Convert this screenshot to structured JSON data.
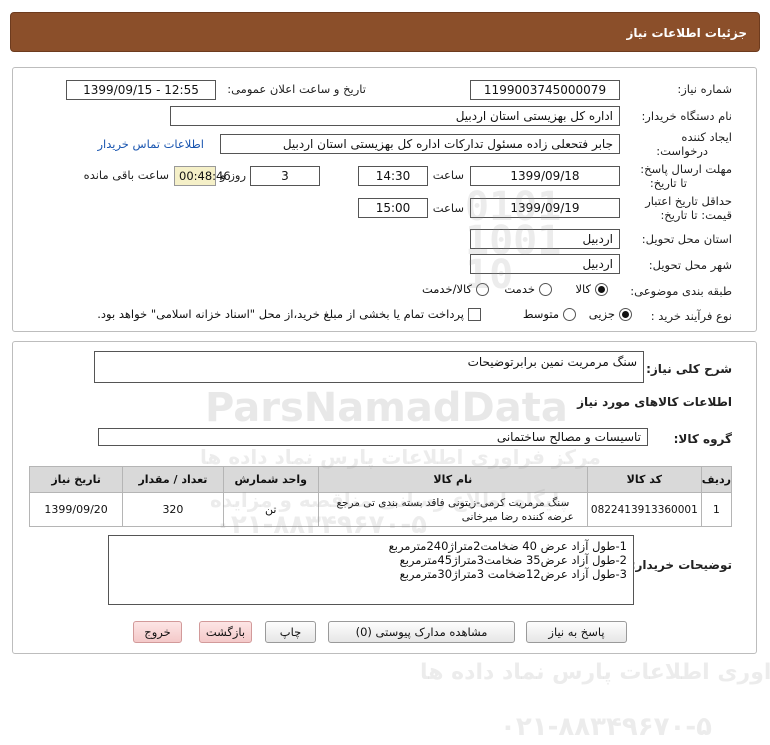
{
  "window": {
    "title": "جزئیات اطلاعات نیاز"
  },
  "form": {
    "need_number_label": "شماره نیاز:",
    "need_number": "1199003745000079",
    "announce_label": "تاریخ و ساعت اعلان عمومی:",
    "announce_value": "1399/09/15 - 12:55",
    "buyer_org_label": "نام دستگاه خریدار:",
    "buyer_org": "اداره کل بهزیستی استان اردبیل",
    "creator_label_1": "ایجاد کننده",
    "creator_label_2": "درخواست:",
    "creator": "جابر فتحعلی زاده مسئول تدارکات اداره کل بهزیستی استان اردبیل",
    "contact_link": "اطلاعات تماس خریدار",
    "deadline_label_1": "مهلت ارسال پاسخ:",
    "deadline_label_2": "تا تاریخ:",
    "deadline_date": "1399/09/18",
    "time_label": "ساعت",
    "deadline_time": "14:30",
    "days_value": "3",
    "days_label": "روز و",
    "remaining_time": "00:48:46",
    "remaining_label": "ساعت باقی مانده",
    "validity_label_1": "حداقل تاریخ اعتبار",
    "validity_label_2": "قیمت: تا تاریخ:",
    "validity_date": "1399/09/19",
    "validity_time_label": "ساعت",
    "validity_time": "15:00",
    "province_label": "استان محل تحویل:",
    "province": "اردبیل",
    "city_label": "شهر محل تحویل:",
    "city": "اردبیل",
    "category_label": "طبقه بندی موضوعی:",
    "category_options": [
      "کالا",
      "خدمت",
      "کالا/خدمت"
    ],
    "category_selected": "کالا",
    "process_label": "نوع فرآیند خرید :",
    "process_options": [
      "جزیی",
      "متوسط"
    ],
    "process_selected": "جزیی",
    "payment_note": "پرداخت تمام یا بخشی از مبلغ خرید،از محل \"اسناد خزانه اسلامی\" خواهد بود."
  },
  "need": {
    "summary_label": "شرح کلی نیاز:",
    "summary": "سنگ مرمریت نمین برابرتوضیحات",
    "goods_info_title": "اطلاعات کالاهای مورد نیاز",
    "group_label": "گروه کالا:",
    "group_value": "تاسیسات و مصالح ساختمانی"
  },
  "table": {
    "headers": [
      "ردیف",
      "کد کالا",
      "نام کالا",
      "واحد شمارش",
      "تعداد / مقدار",
      "تاریخ نیاز"
    ],
    "rows": [
      {
        "row": "1",
        "code": "0822413913360001",
        "name_line1": "سنگ مرمریت کرمی-زیتونی فاقد بسته بندی تی مرجع",
        "name_line2": "عرضه کننده رضا میرخانی",
        "unit": "تن",
        "qty": "320",
        "date": "1399/09/20"
      }
    ]
  },
  "buyer_notes": {
    "label": "توضیحات خریدار:",
    "lines": [
      "1-طول آزاد عرض 40 ضخامت2متراژ240مترمربع",
      "2-طول آزاد عرض35 ضخامت3متراژ45مترمربع",
      "3-طول آزاد عرض12ضخامت 3متراژ30مترمربع"
    ]
  },
  "buttons": {
    "reply": "پاسخ به نیاز",
    "attachments": "مشاهده مدارک پیوستی (0)",
    "print": "چاپ",
    "back": "بازگشت",
    "exit": "خروج"
  },
  "watermark": {
    "brand": "ParsNamadData",
    "tagline": "مرکز فراوری اطلاعات پارس نماد داده ها",
    "tagline2": "پایگاه اطلاع رسانی مناقصه و مزایده",
    "phone": "۰۲۱-۸۸۳۴۹۶۷۰-۵"
  },
  "colors": {
    "title_bg": "#8b4f2a",
    "link": "#1a56b0",
    "remaining_bg": "#f5f0c8",
    "header_bg": "#d9d9d9",
    "exit_bg": "#f4c9c9"
  }
}
